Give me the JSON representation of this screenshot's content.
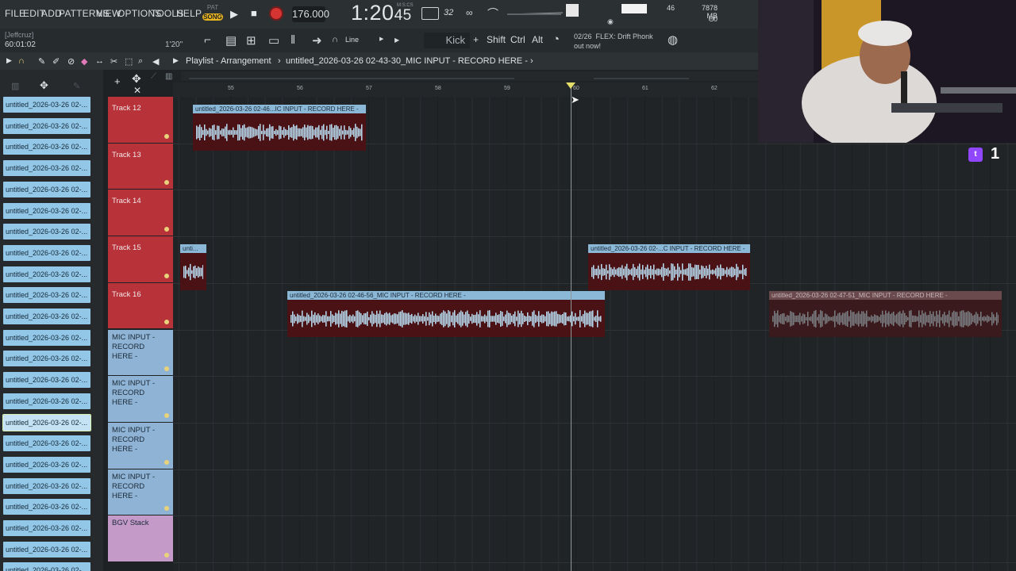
{
  "menu": [
    "FILE",
    "EDIT",
    "ADD",
    "PATTERNS",
    "VIEW",
    "OPTIONS",
    "TOOLS",
    "HELP"
  ],
  "transport": {
    "pat_label": "PAT",
    "song_label": "SONG",
    "tempo": "176.000",
    "time_main": "1:20",
    "time_sec": "45",
    "time_unit": "M:S:CS",
    "step": "32",
    "cpu_value": "46",
    "memory": "7878 MB",
    "polyphony": "0"
  },
  "toolbar": {
    "user": "[Jeffcruz]",
    "position": "60:01:02",
    "zoom_time": "1'20\"",
    "snap": "Line",
    "channel": "Kick",
    "plus": "+",
    "shift": "Shift",
    "ctrl": "Ctrl",
    "alt": "Alt",
    "news_count": "02/26",
    "news_line1": "FLEX: Drift Phonk",
    "news_line2": "out now!"
  },
  "playlist": {
    "title": "Playlist - Arrangement",
    "separator": "›",
    "project": "untitled_2026-03-26 02-43-30_MIC INPUT - RECORD HERE -",
    "bars": [
      "55",
      "56",
      "57",
      "58",
      "59",
      "60",
      "61",
      "62"
    ]
  },
  "browser": {
    "clips": [
      "untitled_2026-03-26 02-...",
      "untitled_2026-03-26 02-...",
      "untitled_2026-03-26 02-...",
      "untitled_2026-03-26 02-...",
      "untitled_2026-03-26 02-...",
      "untitled_2026-03-26 02-...",
      "untitled_2026-03-26 02-...",
      "untitled_2026-03-26 02-...",
      "untitled_2026-03-26 02-...",
      "untitled_2026-03-26 02-...",
      "untitled_2026-03-26 02-...",
      "untitled_2026-03-26 02-...",
      "untitled_2026-03-26 02-...",
      "untitled_2026-03-26 02-...",
      "untitled_2026-03-26 02-...",
      "untitled_2026-03-26 02-...",
      "untitled_2026-03-26 02-...",
      "untitled_2026-03-26 02-...",
      "untitled_2026-03-26 02-...",
      "untitled_2026-03-26 02-...",
      "untitled_2026-03-26 02-...",
      "untitled_2026-03-26 02-...",
      "untitled_2026-03-26 02-..."
    ],
    "selected_index": 15
  },
  "tracks": [
    {
      "name": "Track 12",
      "color": "red"
    },
    {
      "name": "Track 13",
      "color": "red"
    },
    {
      "name": "Track 14",
      "color": "red"
    },
    {
      "name": "Track 15",
      "color": "red"
    },
    {
      "name": "Track 16",
      "color": "red"
    },
    {
      "name": "MIC INPUT - RECORD HERE -",
      "color": "blue"
    },
    {
      "name": "MIC INPUT - RECORD HERE -",
      "color": "blue"
    },
    {
      "name": "MIC INPUT - RECORD HERE -",
      "color": "blue"
    },
    {
      "name": "MIC INPUT - RECORD HERE -",
      "color": "blue"
    },
    {
      "name": "BGV Stack",
      "color": "pink"
    }
  ],
  "audio_clips": [
    {
      "label": "untitled_2026-03-26 02-46...IC INPUT - RECORD HERE -",
      "track": 0,
      "muted": false
    },
    {
      "label": "unti...",
      "track": 3,
      "muted": false
    },
    {
      "label": "untitled_2026-03-26 02-...C INPUT - RECORD HERE -",
      "track": 3,
      "muted": false
    },
    {
      "label": "untitled_2026-03-26 02-46-56_MIC INPUT - RECORD HERE -",
      "track": 4,
      "muted": false
    },
    {
      "label": "untitled_2026-03-26 02-47-51_MIC INPUT - RECORD HERE -",
      "track": 4,
      "muted": true
    }
  ],
  "twitch": {
    "count": "1"
  },
  "colors": {
    "track_red": "#b8323a",
    "clip_blue": "#8cb8d8",
    "accent_yellow": "#e8b520",
    "record_red": "#d63333"
  }
}
